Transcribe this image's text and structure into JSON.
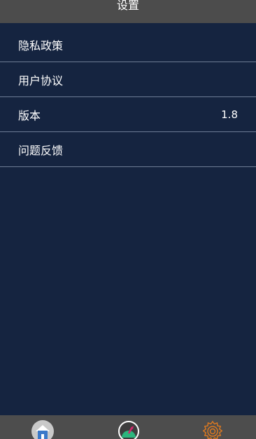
{
  "header": {
    "title": "设置"
  },
  "menu": {
    "items": [
      {
        "label": "隐私政策",
        "value": ""
      },
      {
        "label": "用户协议",
        "value": ""
      },
      {
        "label": "版本",
        "value": "1.8"
      },
      {
        "label": "问题反馈",
        "value": ""
      }
    ]
  },
  "tabbar": {
    "tabs": [
      {
        "icon": "home-icon",
        "active": false
      },
      {
        "icon": "speedometer-icon",
        "active": false
      },
      {
        "icon": "gear-icon",
        "active": true,
        "color": "#e07a1f"
      }
    ]
  },
  "colors": {
    "background": "#152440",
    "header": "#4c4c4c",
    "divider": "#6d7c95",
    "tabbar": "#4d4d4d",
    "accent": "#e07a1f"
  }
}
